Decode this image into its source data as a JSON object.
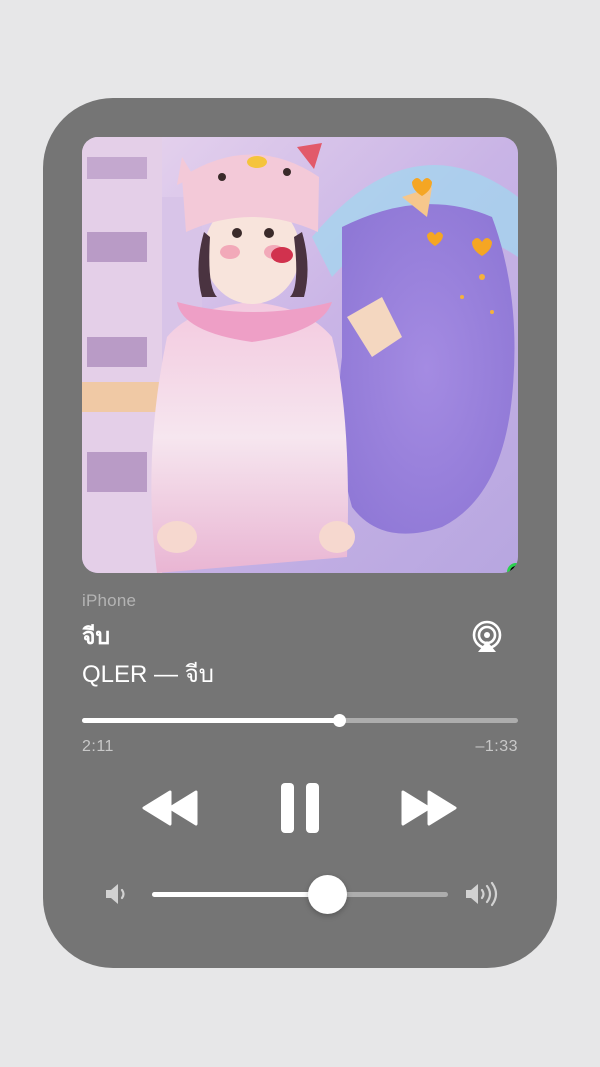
{
  "player": {
    "device": "iPhone",
    "title": "จีบ",
    "subtitle": "QLER — จีบ",
    "elapsed": "2:11",
    "remaining": "–1:33",
    "progress_fraction": 0.59,
    "volume_fraction": 0.59
  },
  "icons": {
    "airplay": "airplay-icon",
    "rewind": "rewind-icon",
    "pause": "pause-icon",
    "forward": "fast-forward-icon",
    "volume_low": "speaker-low-icon",
    "volume_high": "speaker-high-icon",
    "app_badge": "music-app-icon"
  },
  "colors": {
    "card": "#757575",
    "background": "#e7e7e8",
    "badge_border": "#2bd04f",
    "track": "#adadad",
    "fill": "#ffffff"
  }
}
